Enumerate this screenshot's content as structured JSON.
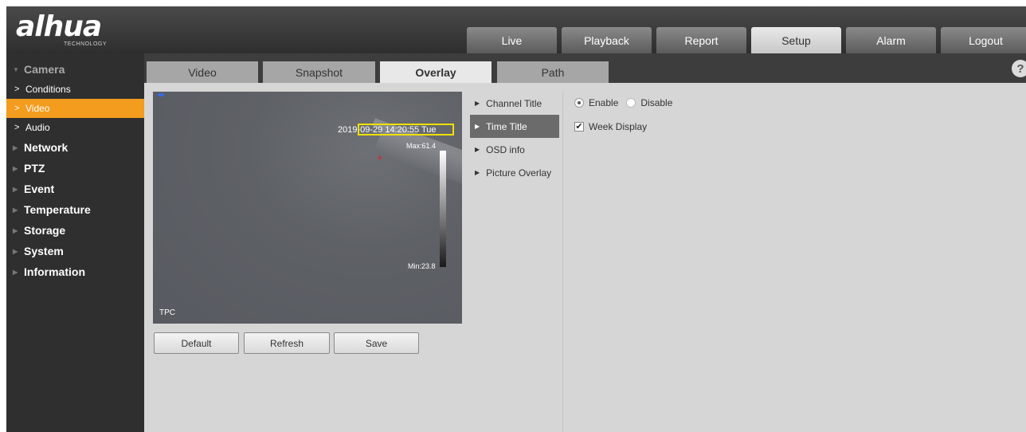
{
  "brand": {
    "name": "alhua",
    "tagline": "TECHNOLOGY"
  },
  "topnav": [
    "Live",
    "Playback",
    "Report",
    "Setup",
    "Alarm",
    "Logout"
  ],
  "topnav_active": "Setup",
  "sidebar": {
    "camera": "Camera",
    "camera_items": [
      "Conditions",
      "Video",
      "Audio"
    ],
    "active_item": "Video",
    "categories": [
      "Network",
      "PTZ",
      "Event",
      "Temperature",
      "Storage",
      "System",
      "Information"
    ]
  },
  "subtabs": [
    "Video",
    "Snapshot",
    "Overlay",
    "Path"
  ],
  "subtab_active": "Overlay",
  "help_label": "?",
  "preview": {
    "time_osd": "2019-09-29 14:20:55 Tue",
    "max_label": "Max:61.4",
    "min_label": "Min:23.8",
    "channel_osd": "TPC"
  },
  "buttons": {
    "default": "Default",
    "refresh": "Refresh",
    "save": "Save"
  },
  "overlay_types": [
    "Channel Title",
    "Time Title",
    "OSD info",
    "Picture Overlay"
  ],
  "overlay_type_active": "Time Title",
  "settings": {
    "enable": "Enable",
    "disable": "Disable",
    "week_display": "Week Display"
  },
  "colors": {
    "accent": "#f39c1e",
    "header": "#3a3a3a",
    "sidebar": "#2f2f2f",
    "osd_box": "#f0e000"
  }
}
